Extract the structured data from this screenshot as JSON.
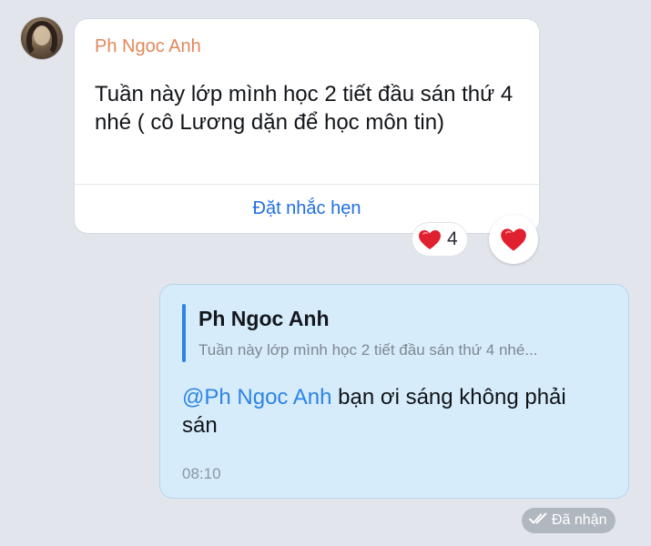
{
  "received_message": {
    "sender_name": "Ph Ngoc Anh",
    "text": "Tuần này lớp mình học 2 tiết đầu sán thứ 4 nhé ( cô Lương dặn để học môn tin)",
    "action_label": "Đặt nhắc hẹn",
    "reaction": {
      "icon": "heart-icon",
      "count": "4"
    }
  },
  "sent_message": {
    "quote": {
      "name": "Ph Ngoc Anh",
      "text": "Tuần này lớp mình học 2 tiết đầu sán thứ 4 nhé..."
    },
    "mention": "@Ph Ngoc Anh",
    "text": " bạn ơi sáng không phải sán",
    "time": "08:10"
  },
  "status": {
    "icon": "double-check-icon",
    "label": "Đã nhận"
  },
  "colors": {
    "background": "#e2e6ec",
    "sender_name": "#e2875a",
    "link_blue": "#1f6fe0",
    "sent_bubble": "#d6ecfb",
    "heart": "#e0202f"
  }
}
